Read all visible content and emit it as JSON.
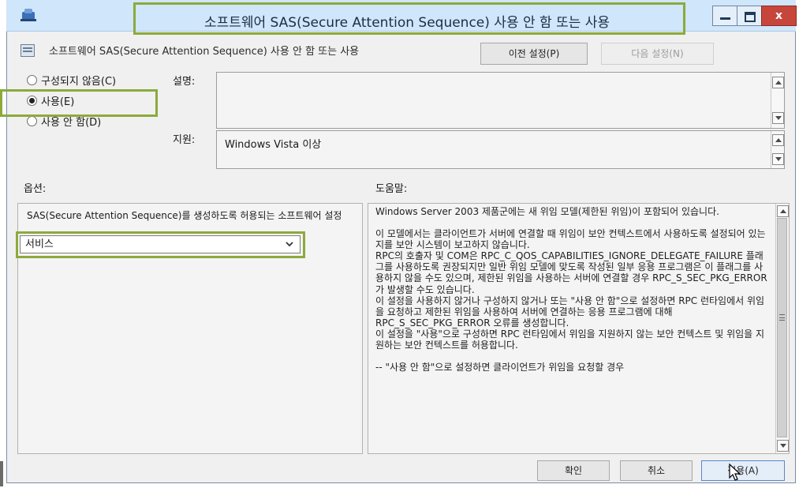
{
  "window": {
    "title": "소프트웨어 SAS(Secure Attention Sequence) 사용 안 함 또는 사용",
    "close_glyph": "x",
    "icons": [
      "app-icon",
      "minimize-icon",
      "maximize-icon",
      "close-icon"
    ]
  },
  "header": {
    "policy_name": "소프트웨어 SAS(Secure Attention Sequence) 사용 안 함 또는 사용",
    "prev_button": "이전 설정(P)",
    "next_button": "다음 설정(N)"
  },
  "state": {
    "radios": [
      {
        "label": "구성되지 않음(C)",
        "selected": false
      },
      {
        "label": "사용(E)",
        "selected": true
      },
      {
        "label": "사용 안 함(D)",
        "selected": false
      }
    ]
  },
  "fields": {
    "comment_label": "설명:",
    "comment_value": "",
    "supported_label": "지원:",
    "supported_value": "Windows Vista 이상"
  },
  "options": {
    "label": "옵션:",
    "description": "SAS(Secure Attention Sequence)를 생성하도록 허용되는 소프트웨어 설정",
    "select_value": "서비스"
  },
  "help": {
    "label": "도움말:",
    "paragraphs": [
      "Windows Server 2003 제품군에는 새 위임 모델(제한된 위임)이 포함되어 있습니다.",
      "",
      "이 모델에서는 클라이언트가 서버에 연결할 때 위임이 보안 컨텍스트에서 사용하도록 설정되어 있는지를 보안 시스템이 보고하지 않습니다.",
      "RPC의 호출자 및 COM은 RPC_C_QOS_CAPABILITIES_IGNORE_DELEGATE_FAILURE 플래그를 사용하도록 권장되지만 일반 위임 모델에 맞도록 작성된 일부 응용 프로그램은 이 플래그를 사용하지 않을 수도 있으며, 제한된 위임을 사용하는 서버에 연결할 경우 RPC_S_SEC_PKG_ERROR가 발생할 수도 있습니다.",
      "이 설정을 사용하지 않거나 구성하지 않거나 또는 \"사용 안 함\"으로 설정하면 RPC 런타임에서 위임을 요청하고 제한된 위임을 사용하여 서버에 연결하는 응용 프로그램에 대해 RPC_S_SEC_PKG_ERROR 오류를 생성합니다.",
      "이 설정을 \"사용\"으로 구성하면 RPC 런타임에서 위임을 지원하지 않는 보안 컨텍스트 및 위임을 지원하는 보안 컨텍스트를 허용합니다.",
      "",
      "-- \"사용 안 함\"으로 설정하면 클라이언트가 위임을 요청할 경우"
    ]
  },
  "footer": {
    "ok": "확인",
    "cancel": "취소",
    "apply": "적용(A)"
  },
  "colors": {
    "titlebar": "#cfe6fb",
    "highlight": "#8caa3c",
    "close_button": "#c7463c",
    "window_bg": "#f0f0f0"
  }
}
